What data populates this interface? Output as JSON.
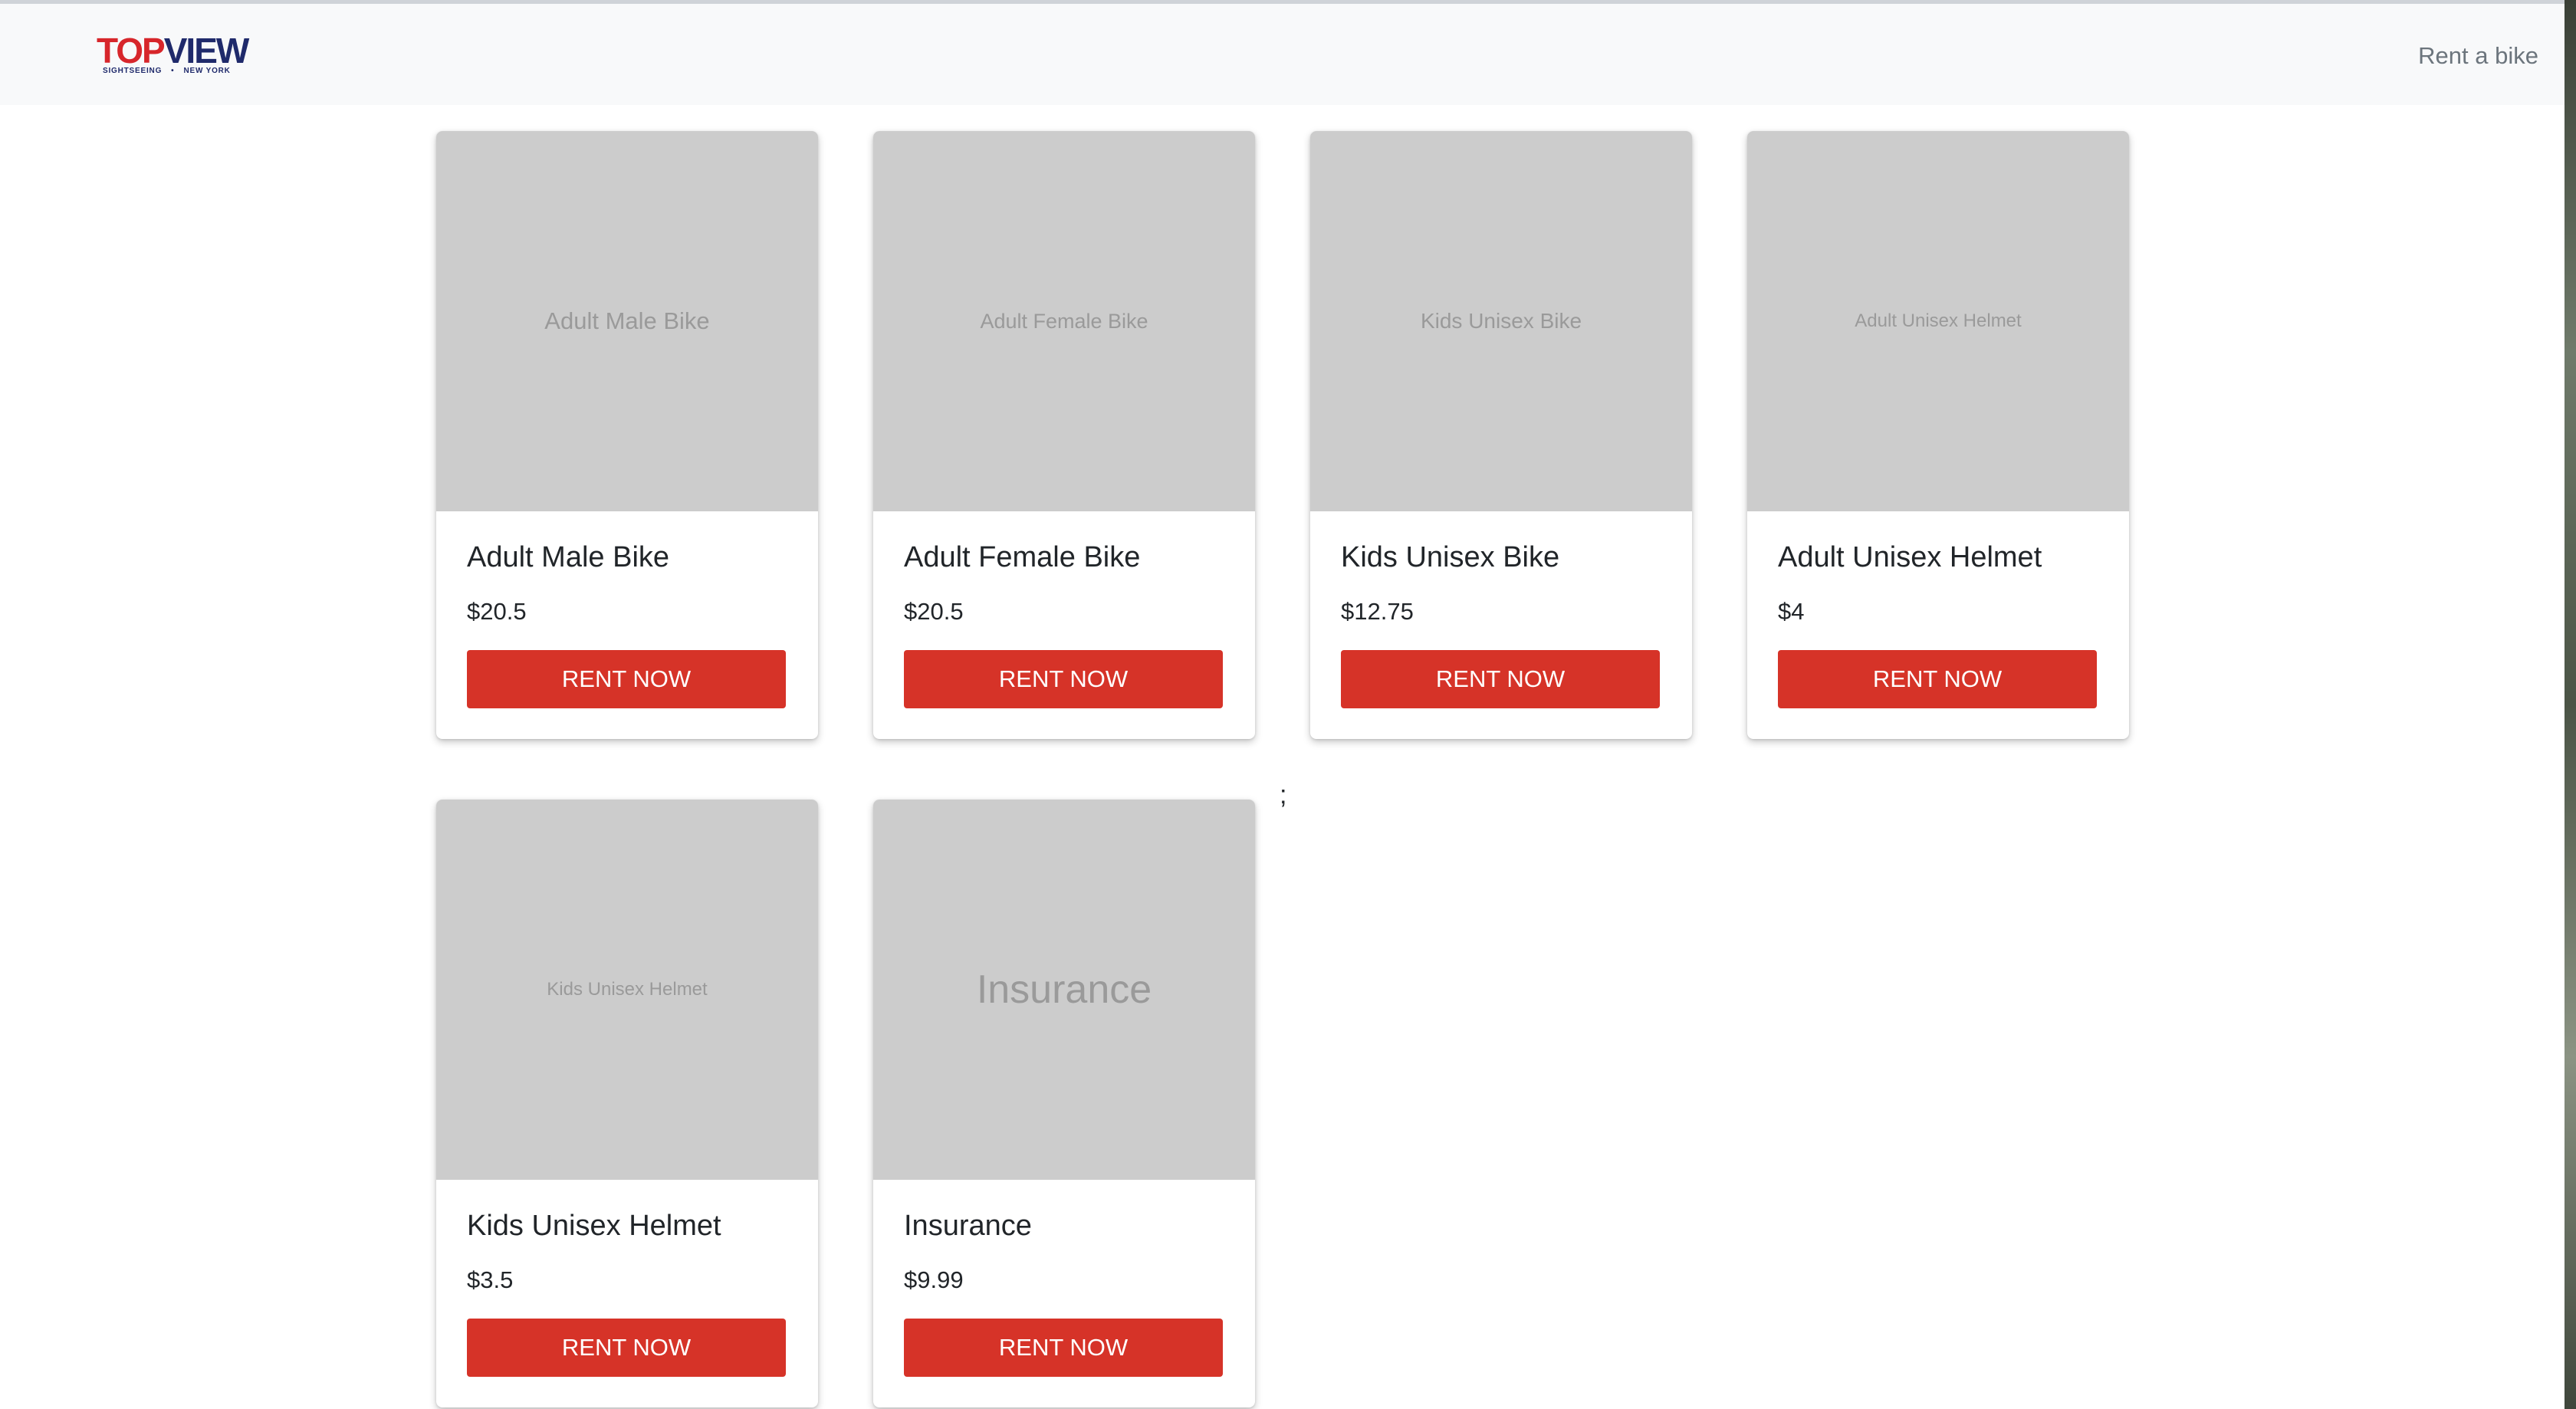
{
  "navbar": {
    "logo": {
      "top": "TOP",
      "view": "VIEW",
      "sub_left": "SIGHTSEEING",
      "sub_sep": "•",
      "sub_right": "NEW YORK"
    },
    "link": "Rent a bike"
  },
  "products": [
    {
      "image_text": "Adult Male Bike",
      "title": "Adult Male Bike",
      "price": "$20.5",
      "button": "RENT NOW"
    },
    {
      "image_text": "Adult Female Bike",
      "title": "Adult Female Bike",
      "price": "$20.5",
      "button": "RENT NOW"
    },
    {
      "image_text": "Kids Unisex Bike",
      "title": "Kids Unisex Bike",
      "price": "$12.75",
      "button": "RENT NOW"
    },
    {
      "image_text": "Adult Unisex Helmet",
      "title": "Adult Unisex Helmet",
      "price": "$4",
      "button": "RENT NOW"
    },
    {
      "image_text": "Kids Unisex Helmet",
      "title": "Kids Unisex Helmet",
      "price": "$3.5",
      "button": "RENT NOW"
    },
    {
      "image_text": "Insurance",
      "title": "Insurance",
      "price": "$9.99",
      "button": "RENT NOW"
    }
  ],
  "stray_text": ";"
}
